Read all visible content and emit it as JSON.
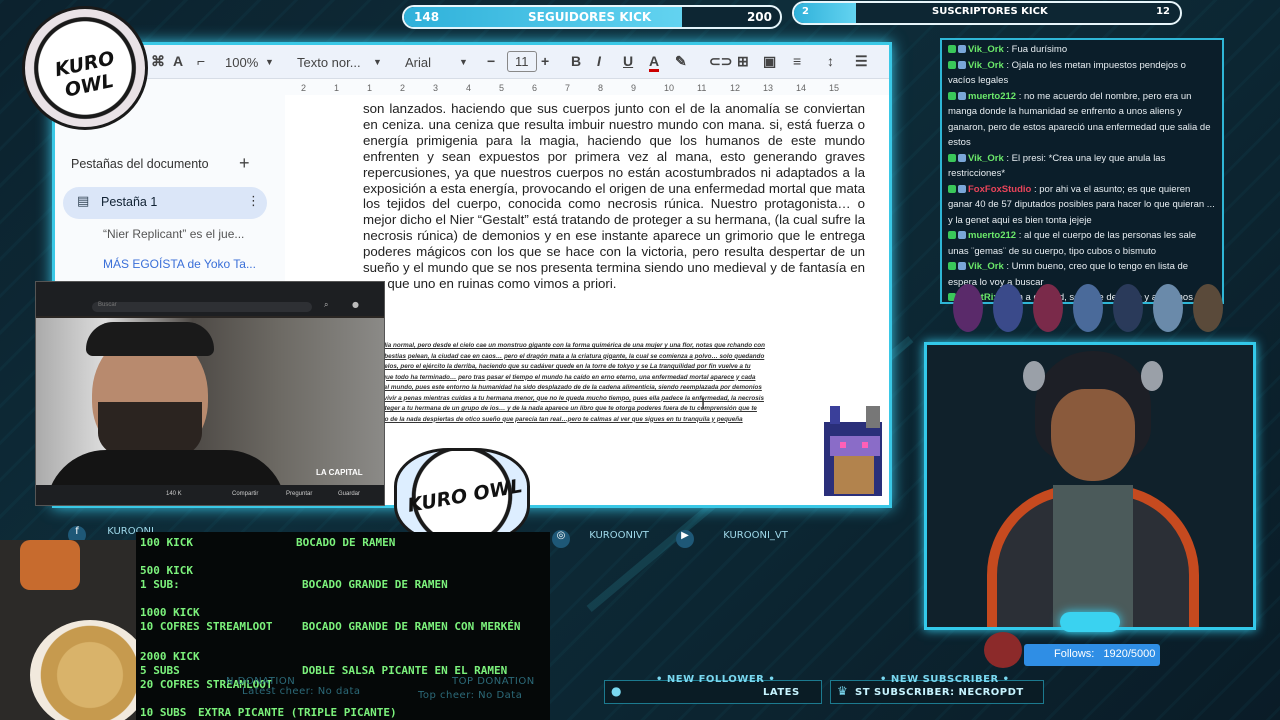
{
  "top_bars": {
    "followers": {
      "current": "148",
      "label": "SEGUIDORES KICK",
      "goal": "200"
    },
    "subs": {
      "current": "2",
      "label": "SUSCRIPTORES KICK",
      "goal": "12"
    }
  },
  "toolbar": {
    "zoom": "100%",
    "style": "Texto nor...",
    "font": "Arial",
    "size": "11"
  },
  "sidebar": {
    "title": "Pestañas del documento",
    "add": "+",
    "tab": "Pestaña 1",
    "more": "⋮",
    "links": [
      "“Nier Replicant” es el jue...",
      "MÁS EGOÍSTA de Yoko Ta..."
    ]
  },
  "ruler": [
    "2",
    "1",
    "1",
    "2",
    "3",
    "4",
    "5",
    "6",
    "7",
    "8",
    "9",
    "10",
    "11",
    "12",
    "13",
    "14",
    "15"
  ],
  "document": {
    "paragraph": "son lanzados. haciendo que sus cuerpos junto con el de la anomalía se conviertan en ceniza. una ceniza que resulta imbuir nuestro mundo con mana. si, está fuerza o energía primigenia para la magia, haciendo que los humanos de este mundo enfrenten y sean expuestos por primera vez al mana, esto generando graves repercusiones, ya que nuestros cuerpos no están acostumbrados ni adaptados a la exposición a esta energía, provocando el origen de una enfermedad mortal que mata los tejidos del cuerpo, conocida como necrosis rúnica. Nuestro protagonista… o mejor dicho el Nier “Gestalt” está tratando de proteger a su hermana, (la cual sufre la necrosis rúnica) de demonios y en ese instante aparece un grimorio que le entrega poderes mágicos con los que se hace con la victoria, pero resulta despertar de un sueño y el mundo que se nos presenta termina siendo uno medieval y de fantasía en vez que uno en ruinas como vimos a priori.",
    "small": "vas por la calle como cualquier día normal, pero desde el cielo cae un monstruo gigante con la forma quimérica de una mujer y una flor, notas que rchando con algo parecido a un dragón… las bestias pelean, la ciudad cae en caos… pero el dragón mata a la criatura gigante, la cual se comienza a polvo… solo quedando esa bestia roja dominando los cielos, pero el ejército la derriba, haciendo que su cadáver quede en la torre de tokyo y se La tranquilidad por fin vuelve a tu mundo, creyendo infantilmente que todo ha terminado… pero tras pasar el tiempo el mundo ha caído en erno eterno, una enfermedad mortal aparece y cada vez quedan menos personas en el mundo, pues este entorno la humanidad ha sido desplazado de de la cadena alimenticia, siendo reemplazada por demonios y monstruos. Has logrado sobrevivir a penas mientras cuidas a tu hermana menor, que no le queda mucho tiempo, pues ella padece la enfermedad, la necrosis rúnica. Intentas defenderte y proteger a tu hermana de un grupo de ios… y de la nada aparece un libro que te otorga poderes fuera de tu comprensión que te permiten luchar y sobrevivir. Pero de la nada despiertas de otico sueño que parecía tan real…pero te calmas al ver que sigues en tu tranquila y pequeña aldea!!!!!"
  },
  "chat": [
    {
      "user": "Vik_Ork",
      "text": "Fua durísimo",
      "color": "#6be86a"
    },
    {
      "user": "Vik_Ork",
      "text": "Ojala no les metan impuestos pendejos o vacíos legales",
      "color": "#6be86a"
    },
    {
      "user": "muerto212",
      "text": "no me acuerdo del nombre, pero era un manga donde la humanidad se enfrento a unos aliens y ganaron, pero de estos apareció una enfermedad que salia de estos",
      "color": "#6be86a"
    },
    {
      "user": "Vik_Ork",
      "text": "El presi: *Crea una ley que anula las restricciones*",
      "color": "#6be86a"
    },
    {
      "user": "FoxFoxStudio",
      "text": "por ahi va el asunto; es que quieren ganar 40 de 57 diputados posibles para hacer lo que quieran ... y la genet aqui es bien tonta jejeje",
      "color": "#e8445a"
    },
    {
      "user": "muerto212",
      "text": "al que el cuerpo de las personas les sale unas ¨gemas¨ de su cuerpo, tipo cubos o bismuto",
      "color": "#6be86a"
    },
    {
      "user": "Vik_Ork",
      "text": "Umm bueno, creo que lo tengo en lista de espera lo voy a buscar",
      "color": "#6be86a"
    },
    {
      "user": "BotRix",
      "text": "Ven a discord, se parte del culto y ayudanos a mejorar el contenido! https://discord.com/...Pu",
      "color": "#6be86a"
    }
  ],
  "webcam": {
    "search": "Buscar",
    "channel": "LA CAPITAL",
    "stats": "140 K",
    "share": "Compartir",
    "ask": "Preguntar",
    "save": "Guardar"
  },
  "logo": {
    "text": "KURO OWL"
  },
  "socials": [
    {
      "icon": "facebook-icon",
      "handle": "KUROONI..."
    },
    {
      "icon": "instagram-icon",
      "handle": "KUROONIVT"
    },
    {
      "icon": "youtube-icon",
      "handle": "KUROONI_VT"
    }
  ],
  "menu": [
    {
      "req": "100 KICK",
      "reward": "Bocado de ramen"
    },
    {
      "req": "500 kick\n1 sub:",
      "reward": "Bocado grande de ramen"
    },
    {
      "req": "1000 kick\n10 cofres streamloot",
      "reward": "Bocado grande de ramen con merkén"
    },
    {
      "req": "2000 kick\n5 subs\n20 cofres streamloot",
      "reward": "Doble salsa picante en el ramen"
    },
    {
      "req": "10 subs",
      "reward": "Extra Picante (Triple picante)"
    }
  ],
  "bottom": {
    "top_cheer_label": "Top cheer: No Data",
    "latest_cheer": "Latest cheer: No data",
    "top_donation": "TOP DONATION",
    "new_follower": "• NEW FOLLOWER •",
    "latest_short": "LATES",
    "new_subscriber": "• NEW SUBSCRIBER •",
    "latest_subscriber": "ST SUBSCRIBER: NECROPDT",
    "donation_label": "N DONATION"
  },
  "follows": {
    "label": "Follows:",
    "value": "1920/5000"
  }
}
